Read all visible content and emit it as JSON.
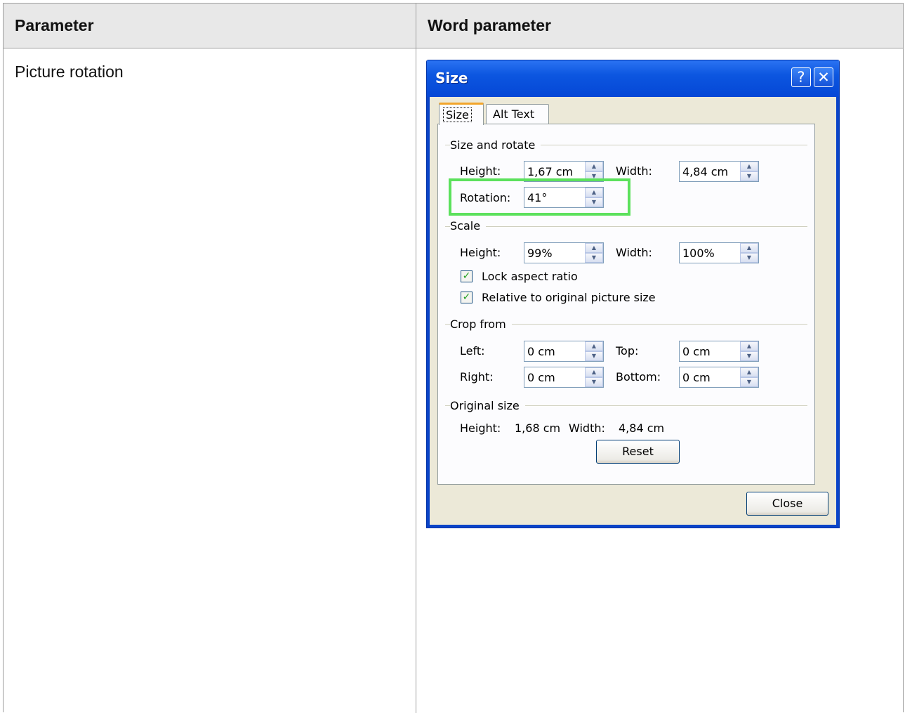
{
  "table": {
    "header_param": "Parameter",
    "header_word": "Word parameter",
    "row_param": "Picture rotation"
  },
  "dialog": {
    "title": "Size",
    "help_glyph": "?",
    "close_glyph": "✕",
    "tabs": [
      "Size",
      "Alt Text"
    ],
    "size_rotate": {
      "group": "Size and rotate",
      "height_label": "Height:",
      "height_value": "1,67 cm",
      "width_label": "Width:",
      "width_value": "4,84 cm",
      "rotation_label": "Rotation:",
      "rotation_value": "41°"
    },
    "scale": {
      "group": "Scale",
      "height_label": "Height:",
      "height_value": "99%",
      "width_label": "Width:",
      "width_value": "100%",
      "lock_aspect": "Lock aspect ratio",
      "relative_original": "Relative to original picture size"
    },
    "crop": {
      "group": "Crop from",
      "left_label": "Left:",
      "left_value": "0 cm",
      "top_label": "Top:",
      "top_value": "0 cm",
      "right_label": "Right:",
      "right_value": "0 cm",
      "bottom_label": "Bottom:",
      "bottom_value": "0 cm"
    },
    "original": {
      "group": "Original size",
      "height_label": "Height:",
      "height_value": "1,68 cm",
      "width_label": "Width:",
      "width_value": "4,84 cm",
      "reset_label": "Reset"
    },
    "close_label": "Close"
  },
  "colors": {
    "highlight": "#5ce15c",
    "titlebar": "#0547d6"
  },
  "icons": {
    "spin_up": "up-arrow-icon",
    "spin_down": "down-arrow-icon",
    "check": "checkmark-icon"
  }
}
